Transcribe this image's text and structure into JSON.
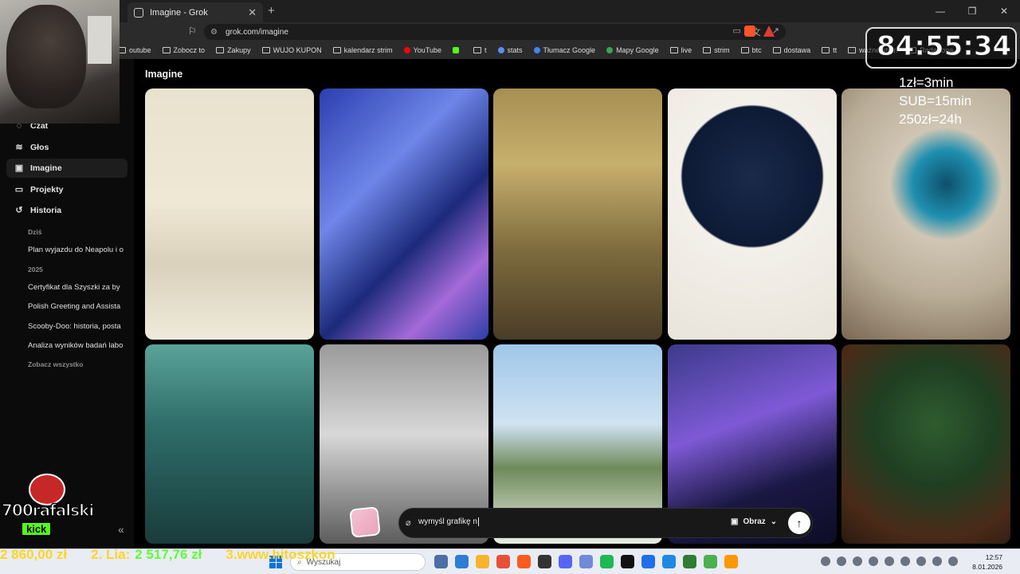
{
  "browser": {
    "tab_title": "Imagine - Grok",
    "url": "grok.com/imagine",
    "bookmarks": [
      "outube",
      "Zobocz to",
      "Zakupy",
      "WUJO KUPON",
      "kalendarz strim",
      "YouTube",
      "",
      "t",
      "stats",
      "Tłumacz Google",
      "Mapy Google",
      "live",
      "strim",
      "btc",
      "dostawa",
      "tt",
      "ważne strim",
      "Radar opa"
    ]
  },
  "sidebar": {
    "nav": [
      {
        "label": "Czat",
        "icon": "chat-icon",
        "glyph": "◌"
      },
      {
        "label": "Głos",
        "icon": "voice-icon",
        "glyph": "≋"
      },
      {
        "label": "Imagine",
        "icon": "image-icon",
        "glyph": "▣"
      },
      {
        "label": "Projekty",
        "icon": "folder-icon",
        "glyph": "▭"
      },
      {
        "label": "Historia",
        "icon": "history-icon",
        "glyph": "↺"
      }
    ],
    "history": {
      "today_label": "Dziś",
      "today": [
        "Plan wyjazdu do Neapolu i o"
      ],
      "year_label": "2025",
      "items": [
        "Certyfikat dla Szyszki za by",
        "Polish Greeting and Assista",
        "Scooby-Doo: historia, posta",
        "Analiza wyników badań labo"
      ],
      "see_all": "Zobacz wszystko"
    }
  },
  "main": {
    "title": "Imagine",
    "images": [
      "winter-sledding-illustration",
      "glass-creature-abstract",
      "man-in-leather-jacket-room",
      "woman-with-flowing-hair",
      "man-at-portal-window",
      "underwater-woman-with-flowers",
      "two-women-vintage-photo",
      "man-running-in-dandelion-field",
      "anime-girl-with-bubbles",
      "cat-in-christmas-gift"
    ]
  },
  "composer": {
    "input_value": "wymyśl grafikę n",
    "mode_label": "Obraz"
  },
  "overlay": {
    "timer": "84:55:34",
    "rate1": "1zł=3min",
    "rate2": "SUB=15min",
    "rate3": "250zł=24h",
    "kick_name": "700rafalski",
    "kick_tag": "kick",
    "ticker1": "2 860,00 zł",
    "ticker2_label": "2. Lia:",
    "ticker2_value": "2 517,76 zł",
    "ticker3": "3.www.hitoszkon"
  },
  "taskbar": {
    "search_placeholder": "Wyszukaj",
    "time": "12:57",
    "date": "8.01.2026"
  },
  "colors": {
    "accent": "#ffffff",
    "kick_green": "#53fc18",
    "ticker_yellow": "#ffd42a",
    "ticker_green": "#5cff3b"
  }
}
